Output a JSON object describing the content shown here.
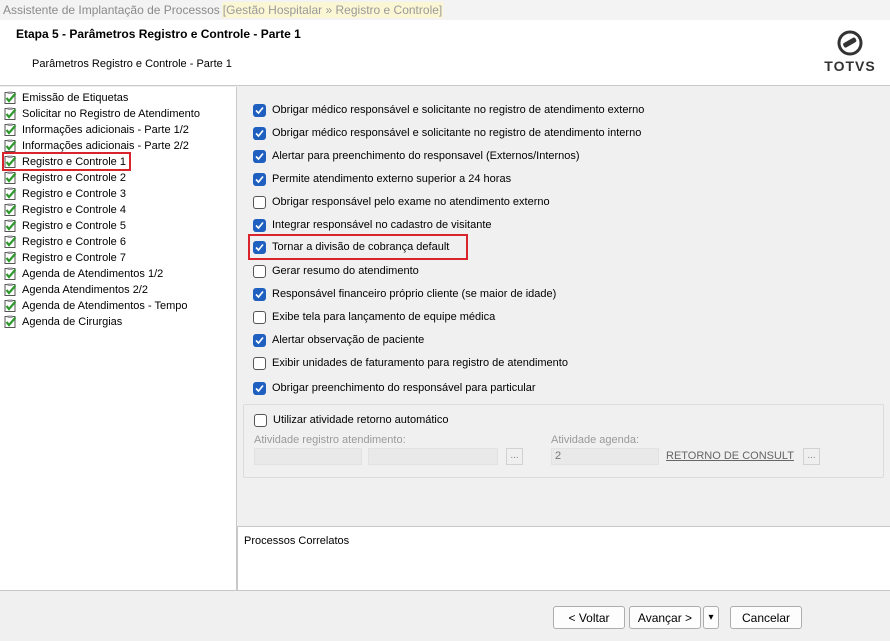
{
  "window": {
    "title": "Assistente de Implantação de Processos",
    "path": "[Gestão Hospitalar » Registro e Controle]"
  },
  "header": {
    "stage_title": "Etapa 5 - Parâmetros Registro e Controle - Parte 1",
    "stage_subtitle": "Parâmetros Registro e Controle - Parte 1",
    "logo_text": "TOTVS"
  },
  "nav": {
    "items": [
      {
        "label": "Emissão de Etiquetas",
        "icon": "checked-clipboard-icon"
      },
      {
        "label": "Solicitar no Registro de Atendimento",
        "icon": "checked-clipboard-icon"
      },
      {
        "label": "Informações adicionais - Parte 1/2",
        "icon": "checked-clipboard-icon"
      },
      {
        "label": "Informações adicionais - Parte 2/2",
        "icon": "checked-clipboard-icon"
      },
      {
        "label": "Registro e Controle 1",
        "icon": "checked-clipboard-icon",
        "selected": true
      },
      {
        "label": "Registro e Controle 2",
        "icon": "checked-clipboard-icon"
      },
      {
        "label": "Registro e Controle 3",
        "icon": "checked-clipboard-icon"
      },
      {
        "label": "Registro e Controle 4",
        "icon": "checked-clipboard-icon"
      },
      {
        "label": "Registro e Controle 5",
        "icon": "checked-clipboard-icon"
      },
      {
        "label": "Registro e Controle 6",
        "icon": "checked-clipboard-icon"
      },
      {
        "label": "Registro e Controle 7",
        "icon": "checked-clipboard-icon"
      },
      {
        "label": "Agenda de Atendimentos 1/2",
        "icon": "checked-clipboard-icon"
      },
      {
        "label": "Agenda Atendimentos 2/2",
        "icon": "checked-clipboard-icon"
      },
      {
        "label": "Agenda de Atendimentos - Tempo",
        "icon": "checked-clipboard-icon"
      },
      {
        "label": "Agenda de Cirurgias",
        "icon": "checked-clipboard-icon"
      }
    ]
  },
  "options": [
    {
      "label": "Obrigar médico responsável e solicitante no registro de atendimento externo",
      "checked": true
    },
    {
      "label": "Obrigar médico responsável e solicitante no registro de atendimento interno",
      "checked": true
    },
    {
      "label": "Alertar para preenchimento do responsavel (Externos/Internos)",
      "checked": true
    },
    {
      "label": "Permite atendimento externo superior a 24 horas",
      "checked": true
    },
    {
      "label": "Obrigar responsável pelo exame no atendimento externo",
      "checked": false
    },
    {
      "label": "Integrar responsável no cadastro de visitante",
      "checked": true
    },
    {
      "label": "Tornar a divisão de cobrança default",
      "checked": true,
      "highlighted": true
    },
    {
      "label": "Gerar resumo do atendimento",
      "checked": false
    },
    {
      "label": "Responsável financeiro próprio cliente (se maior de idade)",
      "checked": true
    },
    {
      "label": "Exibe tela para lançamento de equipe médica",
      "checked": false
    },
    {
      "label": "Alertar observação de paciente",
      "checked": true
    },
    {
      "label": "Exibir unidades de faturamento para registro de atendimento",
      "checked": false
    },
    {
      "label": "Obrigar preenchimento do responsável para particular",
      "checked": true
    }
  ],
  "retorno": {
    "checkbox_label": "Utilizar atividade retorno automático",
    "checked": false,
    "activity_label": "Atividade registro atendimento:",
    "activity_code": "",
    "activity_desc": "",
    "lookup_btn": "...",
    "agenda_label": "Atividade agenda:",
    "agenda_code": "2",
    "agenda_desc": "RETORNO DE CONSULT",
    "agenda_lookup_btn": "..."
  },
  "correlated": {
    "title": "Processos Correlatos"
  },
  "footer": {
    "back_label": "< Voltar",
    "next_label": "Avançar >",
    "dropdown_label": "▾",
    "cancel_label": "Cancelar"
  },
  "colors": {
    "checkbox_on": "#1f5fbf",
    "highlight": "#d9232d",
    "nav_icon_check": "#2e9a2e"
  }
}
